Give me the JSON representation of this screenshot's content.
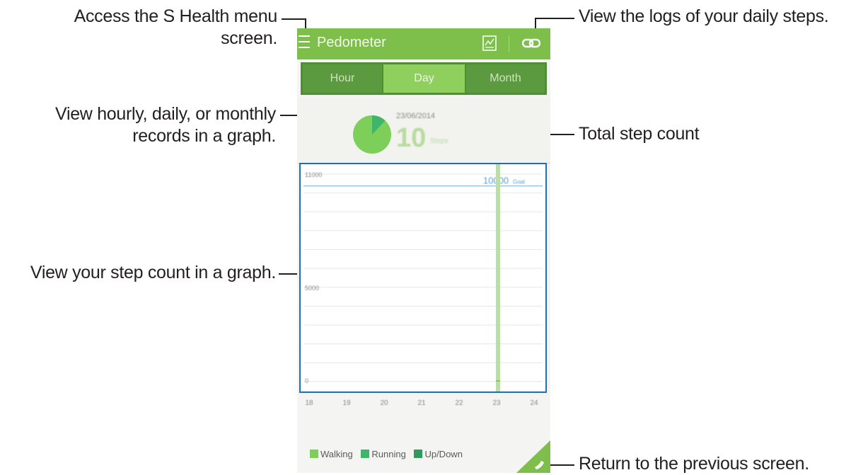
{
  "callouts": {
    "menu": "Access the S Health menu\nscreen.",
    "tabs": "View hourly, daily, or monthly\nrecords in a graph.",
    "graph": "View your step count in a graph.",
    "logs": "View the logs of your daily steps.",
    "total": "Total step count",
    "back": "Return to the previous screen."
  },
  "app": {
    "title": "Pedometer",
    "icons": {
      "menu": "hamburger-menu-icon",
      "chart": "chart-icon",
      "link": "link-icon",
      "back": "shoe-icon"
    },
    "tabs": [
      {
        "label": "Hour",
        "selected": false
      },
      {
        "label": "Day",
        "selected": true
      },
      {
        "label": "Month",
        "selected": false
      }
    ],
    "summary": {
      "date": "23/06/2014",
      "steps": "10",
      "unit": "Steps"
    },
    "legend": [
      {
        "label": "Walking",
        "color": "#7dcf5a"
      },
      {
        "label": "Running",
        "color": "#3fb56a"
      },
      {
        "label": "Up/Down",
        "color": "#2f9a5a"
      }
    ],
    "colors": {
      "accent": "#7dbf4a",
      "tab_dark": "#5b9a3e",
      "tab_selected": "#8fcf5d",
      "graph_border": "#1d70b8"
    }
  },
  "chart_data": {
    "type": "line",
    "x": [
      18,
      19,
      20,
      21,
      22,
      23,
      24
    ],
    "y_ticks": [
      "11000",
      "5000",
      "0"
    ],
    "ylim": [
      0,
      11000
    ],
    "goal": {
      "value": 10000,
      "label": "10000",
      "unit": "Goal"
    },
    "current_hour": 23,
    "series": [
      {
        "values": [
          0,
          0,
          0,
          0,
          0,
          10,
          0
        ]
      }
    ],
    "pie": {
      "walking_fraction": 0.88,
      "running_fraction": 0.12
    }
  }
}
